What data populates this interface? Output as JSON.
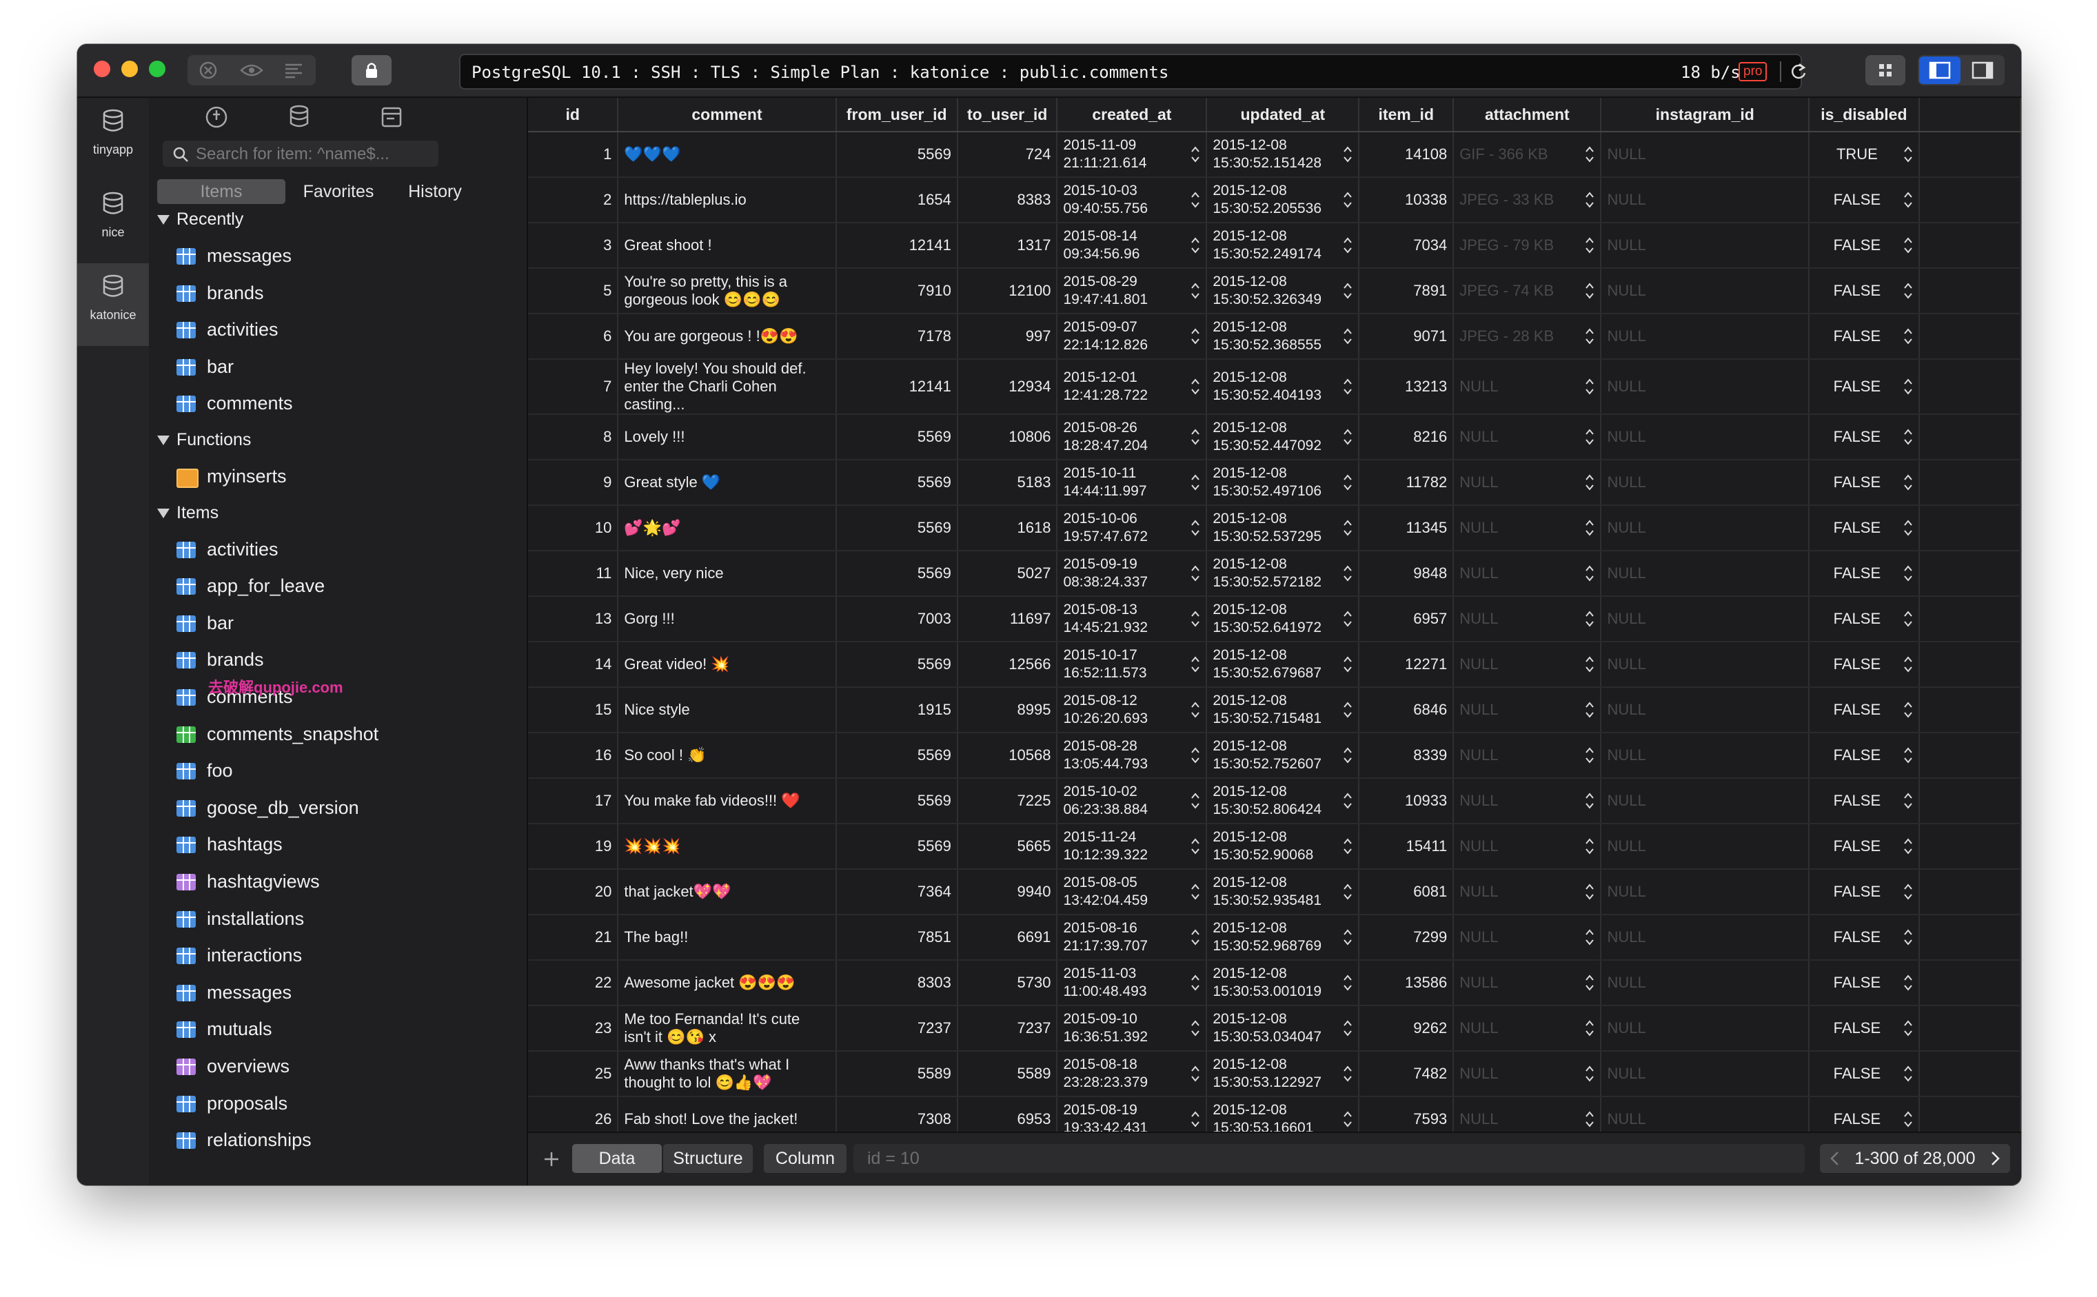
{
  "window": {
    "address": "PostgreSQL 10.1 : SSH : TLS : Simple Plan : katonice : public.comments",
    "speed": "18 b/s",
    "pro_badge": "pro"
  },
  "rail": [
    {
      "label": "tinyapp"
    },
    {
      "label": "nice"
    },
    {
      "label": "katonice"
    }
  ],
  "sidebar": {
    "search_placeholder": "Search for item: ^name$...",
    "segments": [
      "Items",
      "Favorites",
      "History"
    ],
    "groups": [
      {
        "title": "Recently",
        "items": [
          {
            "label": "messages",
            "icon": "table-icon"
          },
          {
            "label": "brands",
            "icon": "table-icon"
          },
          {
            "label": "activities",
            "icon": "table-icon"
          },
          {
            "label": "bar",
            "icon": "table-icon"
          },
          {
            "label": "comments",
            "icon": "table-icon"
          }
        ]
      },
      {
        "title": "Functions",
        "items": [
          {
            "label": "myinserts",
            "icon": "function-icon"
          }
        ]
      },
      {
        "title": "Items",
        "items": [
          {
            "label": "activities",
            "icon": "table-icon"
          },
          {
            "label": "app_for_leave",
            "icon": "table-icon"
          },
          {
            "label": "bar",
            "icon": "table-icon"
          },
          {
            "label": "brands",
            "icon": "table-icon"
          },
          {
            "label": "comments",
            "icon": "table-icon"
          },
          {
            "label": "comments_snapshot",
            "icon": "view-icon"
          },
          {
            "label": "foo",
            "icon": "table-icon"
          },
          {
            "label": "goose_db_version",
            "icon": "table-icon"
          },
          {
            "label": "hashtags",
            "icon": "table-icon"
          },
          {
            "label": "hashtagviews",
            "icon": "materialized-view-icon"
          },
          {
            "label": "installations",
            "icon": "table-icon"
          },
          {
            "label": "interactions",
            "icon": "table-icon"
          },
          {
            "label": "messages",
            "icon": "table-icon"
          },
          {
            "label": "mutuals",
            "icon": "table-icon"
          },
          {
            "label": "overviews",
            "icon": "materialized-view-icon"
          },
          {
            "label": "proposals",
            "icon": "table-icon"
          },
          {
            "label": "relationships",
            "icon": "table-icon"
          }
        ]
      }
    ],
    "schema": "public",
    "watermark": "去破解qupojie.com"
  },
  "colors": {
    "table_icon": "#4a8fe0",
    "view_icon": "#3cb44b",
    "materialized_view_icon": "#b37be0",
    "function_icon": "#f0a030"
  },
  "table": {
    "columns": [
      "id",
      "comment",
      "from_user_id",
      "to_user_id",
      "created_at",
      "updated_at",
      "item_id",
      "attachment",
      "instagram_id",
      "is_disabled"
    ],
    "rows": [
      [
        "1",
        "💙💙💙",
        "5569",
        "724",
        "2015-11-09 21:11:21.614",
        "2015-12-08 15:30:52.151428",
        "14108",
        "GIF - 366 KB",
        "NULL",
        "TRUE"
      ],
      [
        "2",
        "https://tableplus.io",
        "1654",
        "8383",
        "2015-10-03 09:40:55.756",
        "2015-12-08 15:30:52.205536",
        "10338",
        "JPEG - 33 KB",
        "NULL",
        "FALSE"
      ],
      [
        "3",
        "Great shoot !",
        "12141",
        "1317",
        "2015-08-14 09:34:56.96",
        "2015-12-08 15:30:52.249174",
        "7034",
        "JPEG - 79 KB",
        "NULL",
        "FALSE"
      ],
      [
        "5",
        "You're so pretty, this is a gorgeous look 😊😊😊",
        "7910",
        "12100",
        "2015-08-29 19:47:41.801",
        "2015-12-08 15:30:52.326349",
        "7891",
        "JPEG - 74 KB",
        "NULL",
        "FALSE"
      ],
      [
        "6",
        "You are gorgeous ! !😍😍",
        "7178",
        "997",
        "2015-09-07 22:14:12.826",
        "2015-12-08 15:30:52.368555",
        "9071",
        "JPEG - 28 KB",
        "NULL",
        "FALSE"
      ],
      [
        "7",
        "Hey lovely! You should def. enter the Charli Cohen casting...",
        "12141",
        "12934",
        "2015-12-01 12:41:28.722",
        "2015-12-08 15:30:52.404193",
        "13213",
        "NULL",
        "NULL",
        "FALSE"
      ],
      [
        "8",
        "Lovely !!!",
        "5569",
        "10806",
        "2015-08-26 18:28:47.204",
        "2015-12-08 15:30:52.447092",
        "8216",
        "NULL",
        "NULL",
        "FALSE"
      ],
      [
        "9",
        "Great style 💙",
        "5569",
        "5183",
        "2015-10-11 14:44:11.997",
        "2015-12-08 15:30:52.497106",
        "11782",
        "NULL",
        "NULL",
        "FALSE"
      ],
      [
        "10",
        "💕🌟💕",
        "5569",
        "1618",
        "2015-10-06 19:57:47.672",
        "2015-12-08 15:30:52.537295",
        "11345",
        "NULL",
        "NULL",
        "FALSE"
      ],
      [
        "11",
        "Nice, very nice",
        "5569",
        "5027",
        "2015-09-19 08:38:24.337",
        "2015-12-08 15:30:52.572182",
        "9848",
        "NULL",
        "NULL",
        "FALSE"
      ],
      [
        "13",
        "Gorg !!!",
        "7003",
        "11697",
        "2015-08-13 14:45:21.932",
        "2015-12-08 15:30:52.641972",
        "6957",
        "NULL",
        "NULL",
        "FALSE"
      ],
      [
        "14",
        "Great video! 💥",
        "5569",
        "12566",
        "2015-10-17 16:52:11.573",
        "2015-12-08 15:30:52.679687",
        "12271",
        "NULL",
        "NULL",
        "FALSE"
      ],
      [
        "15",
        "Nice style",
        "1915",
        "8995",
        "2015-08-12 10:26:20.693",
        "2015-12-08 15:30:52.715481",
        "6846",
        "NULL",
        "NULL",
        "FALSE"
      ],
      [
        "16",
        "So cool ! 👏",
        "5569",
        "10568",
        "2015-08-28 13:05:44.793",
        "2015-12-08 15:30:52.752607",
        "8339",
        "NULL",
        "NULL",
        "FALSE"
      ],
      [
        "17",
        "You make fab videos!!! ❤️",
        "5569",
        "7225",
        "2015-10-02 06:23:38.884",
        "2015-12-08 15:30:52.806424",
        "10933",
        "NULL",
        "NULL",
        "FALSE"
      ],
      [
        "19",
        "💥💥💥",
        "5569",
        "5665",
        "2015-11-24 10:12:39.322",
        "2015-12-08 15:30:52.90068",
        "15411",
        "NULL",
        "NULL",
        "FALSE"
      ],
      [
        "20",
        "that jacket💖💖",
        "7364",
        "9940",
        "2015-08-05 13:42:04.459",
        "2015-12-08 15:30:52.935481",
        "6081",
        "NULL",
        "NULL",
        "FALSE"
      ],
      [
        "21",
        "The bag!!",
        "7851",
        "6691",
        "2015-08-16 21:17:39.707",
        "2015-12-08 15:30:52.968769",
        "7299",
        "NULL",
        "NULL",
        "FALSE"
      ],
      [
        "22",
        "Awesome jacket 😍😍😍",
        "8303",
        "5730",
        "2015-11-03 11:00:48.493",
        "2015-12-08 15:30:53.001019",
        "13586",
        "NULL",
        "NULL",
        "FALSE"
      ],
      [
        "23",
        "Me too Fernanda! It's cute isn't it 😊😘 x",
        "7237",
        "7237",
        "2015-09-10 16:36:51.392",
        "2015-12-08 15:30:53.034047",
        "9262",
        "NULL",
        "NULL",
        "FALSE"
      ],
      [
        "25",
        "Aww thanks that's what I thought to lol 😊👍💖",
        "5589",
        "5589",
        "2015-08-18 23:28:23.379",
        "2015-12-08 15:30:53.122927",
        "7482",
        "NULL",
        "NULL",
        "FALSE"
      ],
      [
        "26",
        "Fab shot! Love the jacket!",
        "7308",
        "6953",
        "2015-08-19 19:33:42.431",
        "2015-12-08 15:30:53.16601",
        "7593",
        "NULL",
        "NULL",
        "FALSE"
      ]
    ]
  },
  "bottom": {
    "tabs": [
      "Data",
      "Structure"
    ],
    "column_btn": "Column",
    "filter": "id = 10",
    "pager": "1-300 of 28,000"
  }
}
